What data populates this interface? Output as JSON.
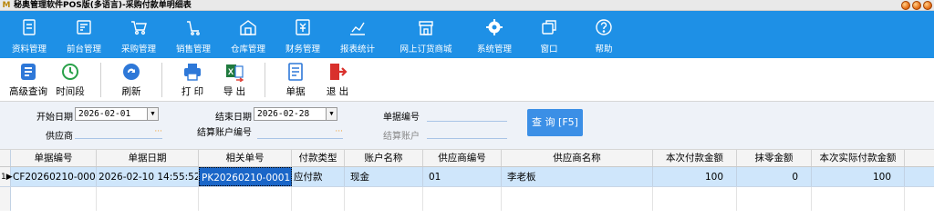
{
  "window": {
    "title": "秘奥管理软件POS版(多语言)-采购付款单明细表"
  },
  "menu": [
    {
      "label": "资料管理",
      "icon": "archive-icon"
    },
    {
      "label": "前台管理",
      "icon": "pos-icon"
    },
    {
      "label": "采购管理",
      "icon": "purchase-icon"
    },
    {
      "label": "销售管理",
      "icon": "cart-icon"
    },
    {
      "label": "仓库管理",
      "icon": "warehouse-icon"
    },
    {
      "label": "财务管理",
      "icon": "finance-icon"
    },
    {
      "label": "报表统计",
      "icon": "chart-icon"
    },
    {
      "label": "网上订货商城",
      "icon": "store-icon"
    },
    {
      "label": "系统管理",
      "icon": "gear-icon"
    },
    {
      "label": "窗口",
      "icon": "window-icon"
    },
    {
      "label": "帮助",
      "icon": "help-icon"
    }
  ],
  "toolbar": {
    "advanced_query": "高级查询",
    "time_period": "时间段",
    "refresh": "刷新",
    "print": "打 印",
    "export": "导 出",
    "voucher": "单据",
    "exit": "退 出"
  },
  "filter": {
    "start_date_label": "开始日期",
    "start_date_value": "2026-02-01",
    "end_date_label": "结束日期",
    "end_date_value": "2026-02-28",
    "doc_no_label": "单据编号",
    "supplier_label": "供应商",
    "settle_account_no_label": "结算账户编号",
    "settle_account_label": "结算账户",
    "search_button": "查 询 [F5]"
  },
  "table": {
    "columns": [
      "单据编号",
      "单据日期",
      "相关单号",
      "付款类型",
      "账户名称",
      "供应商编号",
      "供应商名称",
      "本次付款金额",
      "抹零金额",
      "本次实际付款金额"
    ],
    "rows": [
      {
        "row_no": "1",
        "doc_no": "CF20260210-0001",
        "doc_date": "2026-02-10 14:55:52",
        "related_no": "PK20260210-0001",
        "pay_type": "应付款",
        "account_name": "现金",
        "supplier_no": "01",
        "supplier_name": "李老板",
        "pay_amount": "100",
        "round_off": "0",
        "actual_amount": "100"
      }
    ]
  },
  "colors": {
    "menu_bg": "#1e90e6",
    "row_bg": "#cfe6fb",
    "selected_cell": "#1a66c8",
    "search_btn": "#3b8fe6",
    "exit_red": "#d9302c"
  }
}
